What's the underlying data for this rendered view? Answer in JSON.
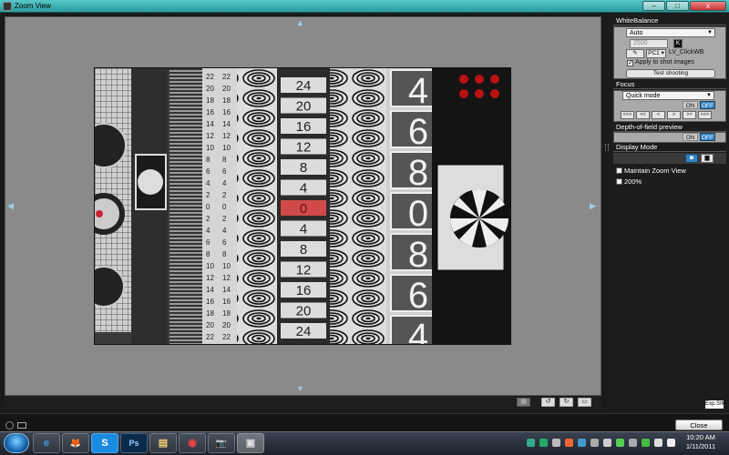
{
  "window": {
    "title": "Zoom View",
    "buttons": {
      "minimize": "–",
      "maximize": "□",
      "close": "x"
    }
  },
  "viewer": {
    "arrows": {
      "up": "▲",
      "down": "▼",
      "left": "◀",
      "right": "▶"
    }
  },
  "preview": {
    "left_scale_top": [
      "22",
      "20",
      "18",
      "16",
      "14",
      "12",
      "10",
      "8",
      "6",
      "4",
      "2",
      "0",
      "2",
      "4",
      "6",
      "8",
      "10",
      "12",
      "14",
      "16",
      "18",
      "20",
      "22"
    ],
    "center_scale": [
      "24",
      "20",
      "16",
      "12",
      "8",
      "4",
      "0",
      "4",
      "8",
      "12",
      "16",
      "20",
      "24"
    ],
    "big_digits": [
      "4",
      "6",
      "8",
      "0",
      "8",
      "6",
      "4"
    ],
    "highlight_color": "#d14a4a"
  },
  "view_tools": [
    "▦",
    "↺",
    "↻",
    "▭"
  ],
  "white_balance": {
    "header": "WhiteBalance",
    "mode": "Auto",
    "kelvin_value": "2500",
    "kelvin_unit": "K",
    "pc_label": "PC1 ▾",
    "preset_name": "LV_ClickWB",
    "apply_label": "Apply to shot images",
    "test_button": "Test shooting"
  },
  "focus": {
    "header": "Focus",
    "mode": "Quick mode",
    "on": "ON",
    "off": "OFF",
    "nav": [
      "<<<",
      "<<",
      "<",
      ">",
      ">>",
      ">>>"
    ]
  },
  "dof": {
    "header": "Depth-of-field preview",
    "on": "ON",
    "off": "OFF"
  },
  "display_mode": {
    "header": "Display Mode",
    "maintain_zoom": "Maintain Zoom View",
    "zoom_200": "200%"
  },
  "exp_sim": "Exp.SIM",
  "close_button": "Close",
  "taskbar": {
    "apps": [
      "e",
      "🦊",
      "S",
      "Ps",
      "▤",
      "◉",
      "📷",
      "▣"
    ],
    "time": "10:20 AM",
    "date": "1/11/2011"
  },
  "colors": {
    "titlebar": "#3fb2b2",
    "accent_blue": "#2f85c8",
    "panel_grey": "#a9a9a9"
  }
}
